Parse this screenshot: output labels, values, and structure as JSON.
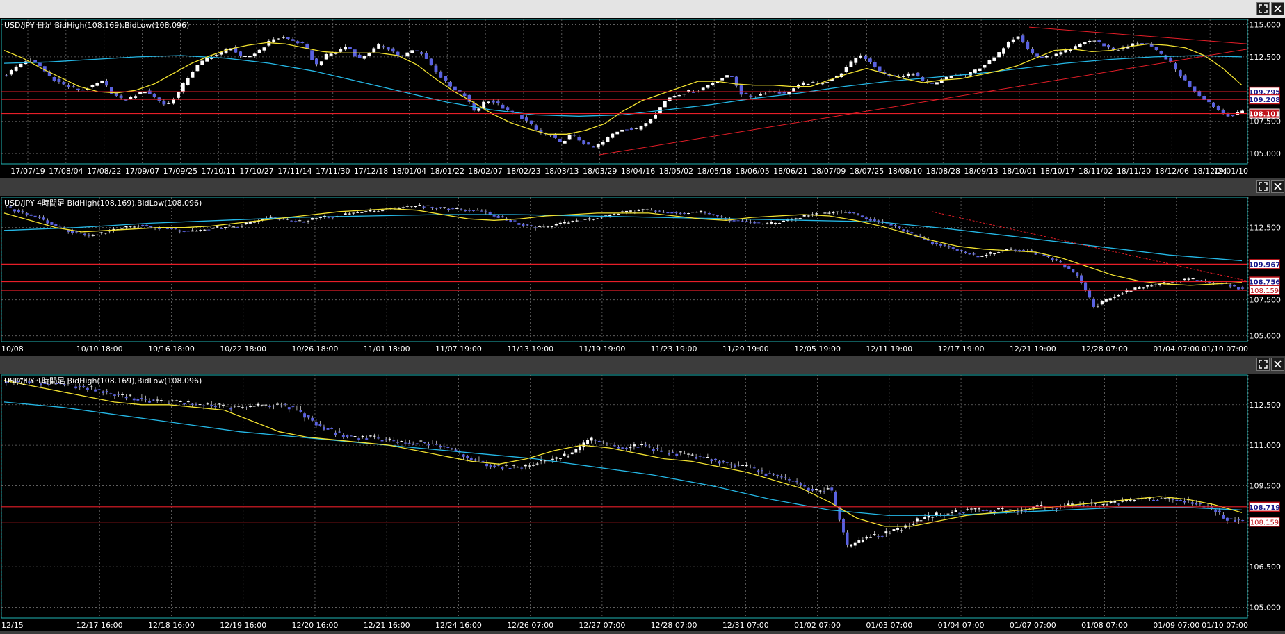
{
  "panels": [
    {
      "id": "daily",
      "title": "USD/JPY 日足  BidHigh(108.169),BidLow(108.096)",
      "y_ticks": [
        {
          "label": "115.000",
          "value": 115.0
        },
        {
          "label": "112.500",
          "value": 112.5
        },
        {
          "label": "107.500",
          "value": 107.5
        },
        {
          "label": "105.000",
          "value": 105.0
        }
      ],
      "y_range": [
        104.2,
        115.4
      ],
      "x_labels": [
        "17/07/19",
        "17/08/04",
        "17/08/22",
        "17/09/07",
        "17/09/25",
        "17/10/11",
        "17/10/27",
        "17/11/14",
        "17/11/30",
        "17/12/18",
        "18/01/04",
        "18/01/22",
        "18/02/07",
        "18/02/23",
        "18/03/13",
        "18/03/29",
        "18/04/16",
        "18/05/02",
        "18/05/18",
        "18/06/05",
        "18/06/21",
        "18/07/09",
        "18/07/25",
        "18/08/10",
        "18/08/28",
        "18/09/13",
        "18/10/01",
        "18/10/17",
        "18/11/02",
        "18/11/20",
        "18/12/06",
        "18/12/24",
        "19/01/10"
      ],
      "h_lines": [
        {
          "label": "109.795",
          "value": 109.795,
          "style": "boxed"
        },
        {
          "label": "109.208",
          "value": 109.208,
          "style": "boxed"
        },
        {
          "label": "108.101",
          "value": 108.101,
          "style": "filled"
        }
      ],
      "close_series": [
        111.1,
        111.8,
        112.3,
        111.9,
        111.0,
        110.5,
        110.1,
        109.9,
        110.2,
        110.6,
        109.6,
        109.1,
        109.5,
        109.9,
        109.3,
        108.7,
        109.6,
        110.9,
        111.9,
        112.5,
        112.7,
        113.3,
        112.4,
        112.6,
        113.2,
        113.9,
        114.0,
        113.7,
        113.4,
        111.8,
        112.6,
        112.9,
        113.4,
        112.3,
        112.8,
        113.4,
        113.1,
        112.4,
        113.0,
        112.8,
        111.7,
        110.7,
        109.9,
        109.5,
        108.2,
        109.2,
        108.9,
        108.3,
        108.0,
        107.4,
        106.6,
        106.4,
        105.8,
        106.5,
        105.9,
        105.4,
        105.9,
        106.6,
        107.0,
        106.8,
        107.4,
        108.2,
        109.3,
        109.6,
        109.8,
        109.9,
        110.4,
        110.8,
        111.1,
        109.6,
        109.4,
        109.7,
        109.9,
        109.6,
        110.1,
        110.5,
        110.4,
        110.6,
        111.0,
        111.8,
        112.7,
        112.2,
        111.3,
        111.0,
        110.9,
        111.3,
        110.6,
        110.3,
        110.8,
        111.1,
        111.0,
        111.5,
        112.0,
        112.6,
        113.7,
        114.2,
        112.9,
        112.4,
        112.5,
        112.8,
        113.1,
        113.6,
        113.8,
        113.4,
        113.0,
        113.2,
        113.6,
        113.5,
        112.9,
        112.3,
        111.2,
        110.3,
        109.5,
        108.9,
        108.2,
        107.9,
        108.3
      ],
      "ma_short": [
        113.0,
        112.4,
        111.6,
        110.9,
        110.2,
        109.8,
        109.7,
        109.9,
        110.4,
        111.2,
        112.0,
        112.6,
        113.1,
        113.4,
        113.6,
        113.5,
        113.2,
        112.9,
        112.8,
        112.8,
        112.8,
        112.6,
        111.9,
        110.8,
        109.8,
        109.0,
        108.1,
        107.4,
        106.9,
        106.5,
        106.5,
        106.8,
        107.3,
        108.3,
        109.1,
        109.6,
        110.1,
        110.6,
        110.6,
        110.4,
        110.3,
        110.3,
        110.2,
        110.2,
        110.7,
        111.2,
        111.6,
        111.2,
        110.8,
        110.5,
        110.7,
        110.8,
        111.1,
        111.4,
        111.8,
        112.4,
        113.0,
        113.1,
        112.9,
        113.0,
        113.3,
        113.5,
        113.4,
        113.2,
        112.6,
        111.6,
        110.3
      ],
      "ma_long": [
        112.0,
        112.1,
        112.3,
        112.5,
        112.6,
        112.4,
        112.0,
        111.4,
        110.6,
        109.8,
        109.0,
        108.4,
        108.0,
        107.9,
        108.0,
        108.4,
        108.8,
        109.3,
        109.7,
        110.2,
        110.6,
        110.9,
        111.2,
        111.6,
        112.0,
        112.3,
        112.5,
        112.6,
        112.5
      ]
    },
    {
      "id": "h4",
      "title": "USD/JPY 4時間足  BidHigh(108.169),BidLow(108.096)",
      "y_ticks": [
        {
          "label": "112.500",
          "value": 112.5
        },
        {
          "label": "107.500",
          "value": 107.5
        },
        {
          "label": "105.000",
          "value": 105.0
        }
      ],
      "y_range": [
        104.6,
        114.6
      ],
      "x_labels": [
        "10/08",
        "10/10 18:00",
        "10/16 18:00",
        "10/22 18:00",
        "10/26 18:00",
        "11/01 18:00",
        "11/07 19:00",
        "11/13 19:00",
        "11/19 19:00",
        "11/23 19:00",
        "11/29 19:00",
        "12/05 19:00",
        "12/11 19:00",
        "12/17 19:00",
        "12/21 19:00",
        "12/28 07:00",
        "01/04 07:00",
        "01/10 07:00"
      ],
      "h_lines": [
        {
          "label": "109.967",
          "value": 109.967,
          "style": "boxed"
        },
        {
          "label": "108.756",
          "value": 108.756,
          "style": "boxed"
        },
        {
          "label": "108.159",
          "value": 108.159,
          "style": "plain"
        }
      ],
      "close_series": [
        113.9,
        113.5,
        113.2,
        112.6,
        112.2,
        112.0,
        112.2,
        112.5,
        112.7,
        112.5,
        112.4,
        112.2,
        112.4,
        112.5,
        112.6,
        112.9,
        113.2,
        113.0,
        112.9,
        113.2,
        113.3,
        113.5,
        113.6,
        113.8,
        113.9,
        114.0,
        113.9,
        113.8,
        113.7,
        113.6,
        113.2,
        112.8,
        112.5,
        112.6,
        112.9,
        113.0,
        113.2,
        113.5,
        113.6,
        113.7,
        113.6,
        113.5,
        113.6,
        113.3,
        113.0,
        112.9,
        112.7,
        112.9,
        113.2,
        113.4,
        113.5,
        113.6,
        113.2,
        112.9,
        112.5,
        112.0,
        111.5,
        111.2,
        110.8,
        110.5,
        110.8,
        111.0,
        110.9,
        110.5,
        110.0,
        109.2,
        107.0,
        107.7,
        108.1,
        108.4,
        108.6,
        108.8,
        108.9,
        108.7,
        108.6,
        108.2
      ],
      "ma_short": [
        113.5,
        113.0,
        112.5,
        112.2,
        112.3,
        112.4,
        112.5,
        112.5,
        112.6,
        112.8,
        113.0,
        113.2,
        113.4,
        113.6,
        113.7,
        113.8,
        113.7,
        113.4,
        113.1,
        113.0,
        113.1,
        113.3,
        113.4,
        113.5,
        113.5,
        113.5,
        113.3,
        113.1,
        113.0,
        113.2,
        113.3,
        113.4,
        113.3,
        113.0,
        112.6,
        112.1,
        111.6,
        111.2,
        111.0,
        110.9,
        110.8,
        110.4,
        109.8,
        109.2,
        108.8,
        108.6,
        108.5,
        108.6,
        108.7
      ],
      "ma_long": [
        112.3,
        112.5,
        112.8,
        113.0,
        113.2,
        113.3,
        113.4,
        113.4,
        113.3,
        113.2,
        113.1,
        113.0,
        112.9,
        112.4,
        111.8,
        111.2,
        110.6,
        110.2
      ]
    },
    {
      "id": "h1",
      "title": "USD/JPY 1時間足  BidHigh(108.169),BidLow(108.096)",
      "y_ticks": [
        {
          "label": "112.500",
          "value": 112.5
        },
        {
          "label": "111.000",
          "value": 111.0
        },
        {
          "label": "109.500",
          "value": 109.5
        },
        {
          "label": "106.500",
          "value": 106.5
        },
        {
          "label": "105.000",
          "value": 105.0
        }
      ],
      "y_range": [
        104.6,
        113.6
      ],
      "x_labels": [
        "12/15",
        "12/17 16:00",
        "12/18 16:00",
        "12/19 16:00",
        "12/20 16:00",
        "12/21 16:00",
        "12/24 16:00",
        "12/26 07:00",
        "12/27 07:00",
        "12/28 07:00",
        "12/31 07:00",
        "01/02 07:00",
        "01/03 07:00",
        "01/04 07:00",
        "01/07 07:00",
        "01/08 07:00",
        "01/09 07:00",
        "01/10 07:00"
      ],
      "h_lines": [
        {
          "label": "108.719",
          "value": 108.719,
          "style": "boxed"
        },
        {
          "label": "108.159",
          "value": 108.159,
          "style": "plain"
        }
      ],
      "close_series": [
        113.4,
        113.4,
        113.3,
        113.3,
        113.2,
        113.1,
        112.9,
        112.8,
        112.7,
        112.6,
        112.6,
        112.5,
        112.5,
        112.4,
        112.4,
        112.5,
        112.5,
        112.3,
        111.8,
        111.5,
        111.3,
        111.3,
        111.2,
        111.1,
        111.1,
        111.0,
        110.8,
        110.5,
        110.3,
        110.2,
        110.2,
        110.4,
        110.5,
        110.7,
        111.2,
        111.0,
        110.9,
        111.0,
        110.8,
        110.7,
        110.6,
        110.5,
        110.3,
        110.2,
        110.0,
        109.8,
        109.6,
        109.3,
        109.4,
        107.2,
        107.6,
        107.7,
        107.9,
        108.2,
        108.4,
        108.5,
        108.6,
        108.6,
        108.6,
        108.6,
        108.7,
        108.7,
        108.8,
        108.8,
        108.8,
        108.9,
        109.0,
        109.0,
        109.0,
        108.9,
        108.7,
        108.3,
        108.2
      ],
      "ma_short": [
        113.4,
        113.2,
        113.0,
        112.8,
        112.6,
        112.5,
        112.5,
        112.4,
        112.3,
        111.9,
        111.5,
        111.3,
        111.2,
        111.1,
        111.0,
        110.8,
        110.6,
        110.4,
        110.3,
        110.5,
        110.8,
        111.0,
        110.9,
        110.7,
        110.5,
        110.4,
        110.2,
        110.0,
        109.7,
        109.4,
        108.9,
        108.3,
        108.0,
        108.0,
        108.2,
        108.4,
        108.5,
        108.6,
        108.7,
        108.8,
        108.9,
        109.0,
        109.1,
        109.0,
        108.8,
        108.5
      ],
      "ma_long": [
        112.6,
        112.4,
        112.1,
        111.8,
        111.5,
        111.3,
        111.1,
        110.9,
        110.7,
        110.5,
        110.2,
        109.9,
        109.5,
        109.0,
        108.6,
        108.4,
        108.4,
        108.5,
        108.6,
        108.7,
        108.7,
        108.6
      ]
    }
  ],
  "colors": {
    "background": "#000000",
    "grid": "#6e6e6e",
    "up_candle": "#ffffff",
    "down_candle": "#5a62e0",
    "ma_short": "#f2e230",
    "ma_long": "#25b8e6",
    "h_line": "#e61e28",
    "trend_line": "#e61e28",
    "axis_text": "#ffffff",
    "frame": "#1fb5b5"
  },
  "icons": {
    "maximize": "maximize-icon",
    "close": "close-icon"
  }
}
